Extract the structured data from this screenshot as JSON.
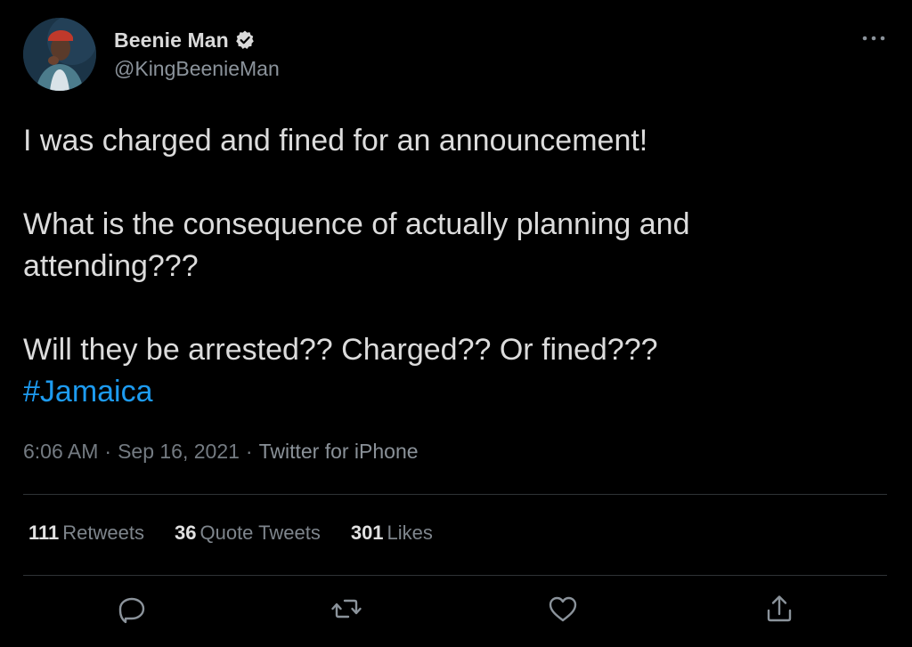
{
  "author": {
    "display_name": "Beenie Man",
    "handle": "@KingBeenieMan",
    "verified": true,
    "verified_color": "#dadada",
    "avatar_background": "#1d3446"
  },
  "tweet": {
    "lines": [
      "I was charged and fined for an announcement!",
      "What is the consequence of actually planning and attending???",
      "Will they be arrested?? Charged?? Or fined???"
    ],
    "hashtag": "#Jamaica",
    "hashtag_color": "#1d9bf0"
  },
  "meta": {
    "time": "6:06 AM",
    "separator": "·",
    "date": "Sep 16, 2021",
    "source": "Twitter for iPhone"
  },
  "stats": {
    "retweets_count": "111",
    "retweets_label": "Retweets",
    "quotes_count": "36",
    "quotes_label": "Quote Tweets",
    "likes_count": "301",
    "likes_label": "Likes"
  },
  "actions": {
    "reply_icon": "reply-icon",
    "retweet_icon": "retweet-icon",
    "like_icon": "heart-icon",
    "share_icon": "share-icon",
    "icon_color": "#8b939b"
  },
  "more_icon": "more-icon",
  "theme": {
    "background": "#000000",
    "text": "#dcdcdc",
    "secondary_text": "#747b82",
    "divider": "#2f3336"
  }
}
